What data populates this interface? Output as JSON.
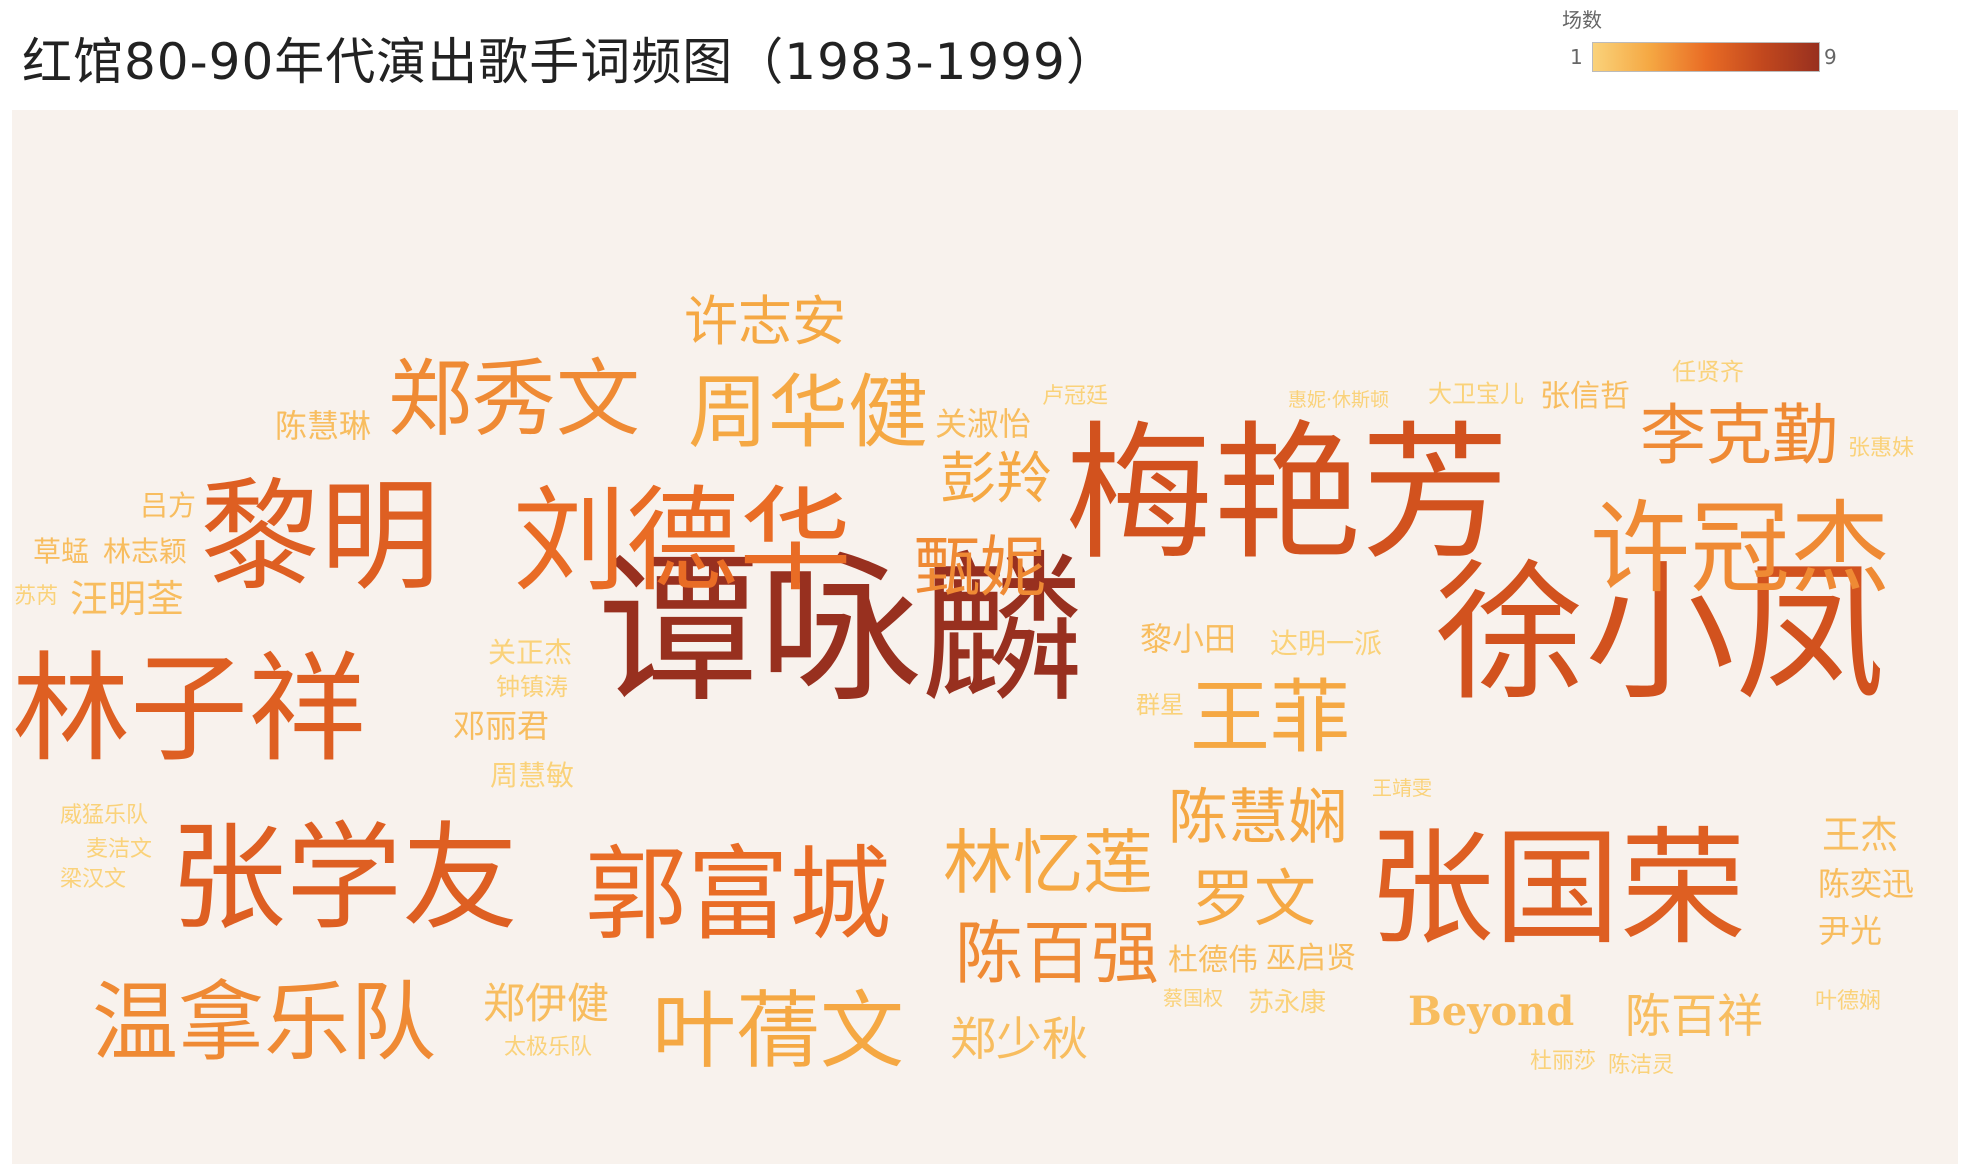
{
  "title": "红馆80-90年代演出歌手词频图（1983-1999）",
  "legend": {
    "title": "场数",
    "min_label": "1",
    "max_label": "9",
    "gradient": [
      "#fad27a",
      "#f5a843",
      "#e96c25",
      "#c2481e",
      "#98301f"
    ]
  },
  "chart_data": {
    "type": "wordcloud",
    "value_name": "场数",
    "value_range": [
      1,
      9
    ],
    "words": [
      {
        "text": "谭咏麟",
        "value": 9
      },
      {
        "text": "梅艳芳",
        "value": 7
      },
      {
        "text": "徐小凤",
        "value": 7
      },
      {
        "text": "张国荣",
        "value": 6
      },
      {
        "text": "林子祥",
        "value": 6
      },
      {
        "text": "张学友",
        "value": 6
      },
      {
        "text": "黎明",
        "value": 6
      },
      {
        "text": "刘德华",
        "value": 5
      },
      {
        "text": "郭富城",
        "value": 5
      },
      {
        "text": "许冠杰",
        "value": 4
      },
      {
        "text": "温拿乐队",
        "value": 4
      },
      {
        "text": "郑秀文",
        "value": 4
      },
      {
        "text": "周华健",
        "value": 3
      },
      {
        "text": "叶蒨文",
        "value": 3
      },
      {
        "text": "李克勤",
        "value": 4
      },
      {
        "text": "王菲",
        "value": 3
      },
      {
        "text": "林忆莲",
        "value": 3
      },
      {
        "text": "陈百强",
        "value": 4
      },
      {
        "text": "陈慧娴",
        "value": 3
      },
      {
        "text": "甄妮",
        "value": 4
      },
      {
        "text": "彭羚",
        "value": 3
      },
      {
        "text": "许志安",
        "value": 3
      },
      {
        "text": "罗文",
        "value": 3
      },
      {
        "text": "郑少秋",
        "value": 2
      },
      {
        "text": "郑伊健",
        "value": 2
      },
      {
        "text": "陈百祥",
        "value": 2
      },
      {
        "text": "Beyond",
        "value": 2
      },
      {
        "text": "汪明荃",
        "value": 2
      },
      {
        "text": "陈慧琳",
        "value": 2
      },
      {
        "text": "关淑怡",
        "value": 2
      },
      {
        "text": "张信哲",
        "value": 2
      },
      {
        "text": "邓丽君",
        "value": 2
      },
      {
        "text": "王杰",
        "value": 2
      },
      {
        "text": "陈奕迅",
        "value": 2
      },
      {
        "text": "尹光",
        "value": 2
      },
      {
        "text": "杜德伟",
        "value": 2
      },
      {
        "text": "巫启贤",
        "value": 2
      },
      {
        "text": "黎小田",
        "value": 2
      },
      {
        "text": "达明一派",
        "value": 1
      },
      {
        "text": "林志颖",
        "value": 2
      },
      {
        "text": "草蜢",
        "value": 2
      },
      {
        "text": "吕方",
        "value": 2
      },
      {
        "text": "关正杰",
        "value": 1
      },
      {
        "text": "周慧敏",
        "value": 1
      },
      {
        "text": "苏永康",
        "value": 1
      },
      {
        "text": "钟镇涛",
        "value": 1
      },
      {
        "text": "任贤齐",
        "value": 1
      },
      {
        "text": "大卫宝儿",
        "value": 1
      },
      {
        "text": "惠妮·休斯顿",
        "value": 1
      },
      {
        "text": "卢冠廷",
        "value": 1
      },
      {
        "text": "张惠妹",
        "value": 1
      },
      {
        "text": "苏芮",
        "value": 1
      },
      {
        "text": "群星",
        "value": 1
      },
      {
        "text": "王靖雯",
        "value": 1
      },
      {
        "text": "威猛乐队",
        "value": 1
      },
      {
        "text": "麦洁文",
        "value": 1
      },
      {
        "text": "梁汉文",
        "value": 1
      },
      {
        "text": "太极乐队",
        "value": 1
      },
      {
        "text": "蔡国权",
        "value": 1
      },
      {
        "text": "叶德娴",
        "value": 1
      },
      {
        "text": "杜丽莎",
        "value": 1
      },
      {
        "text": "陈洁灵",
        "value": 1
      }
    ]
  }
}
